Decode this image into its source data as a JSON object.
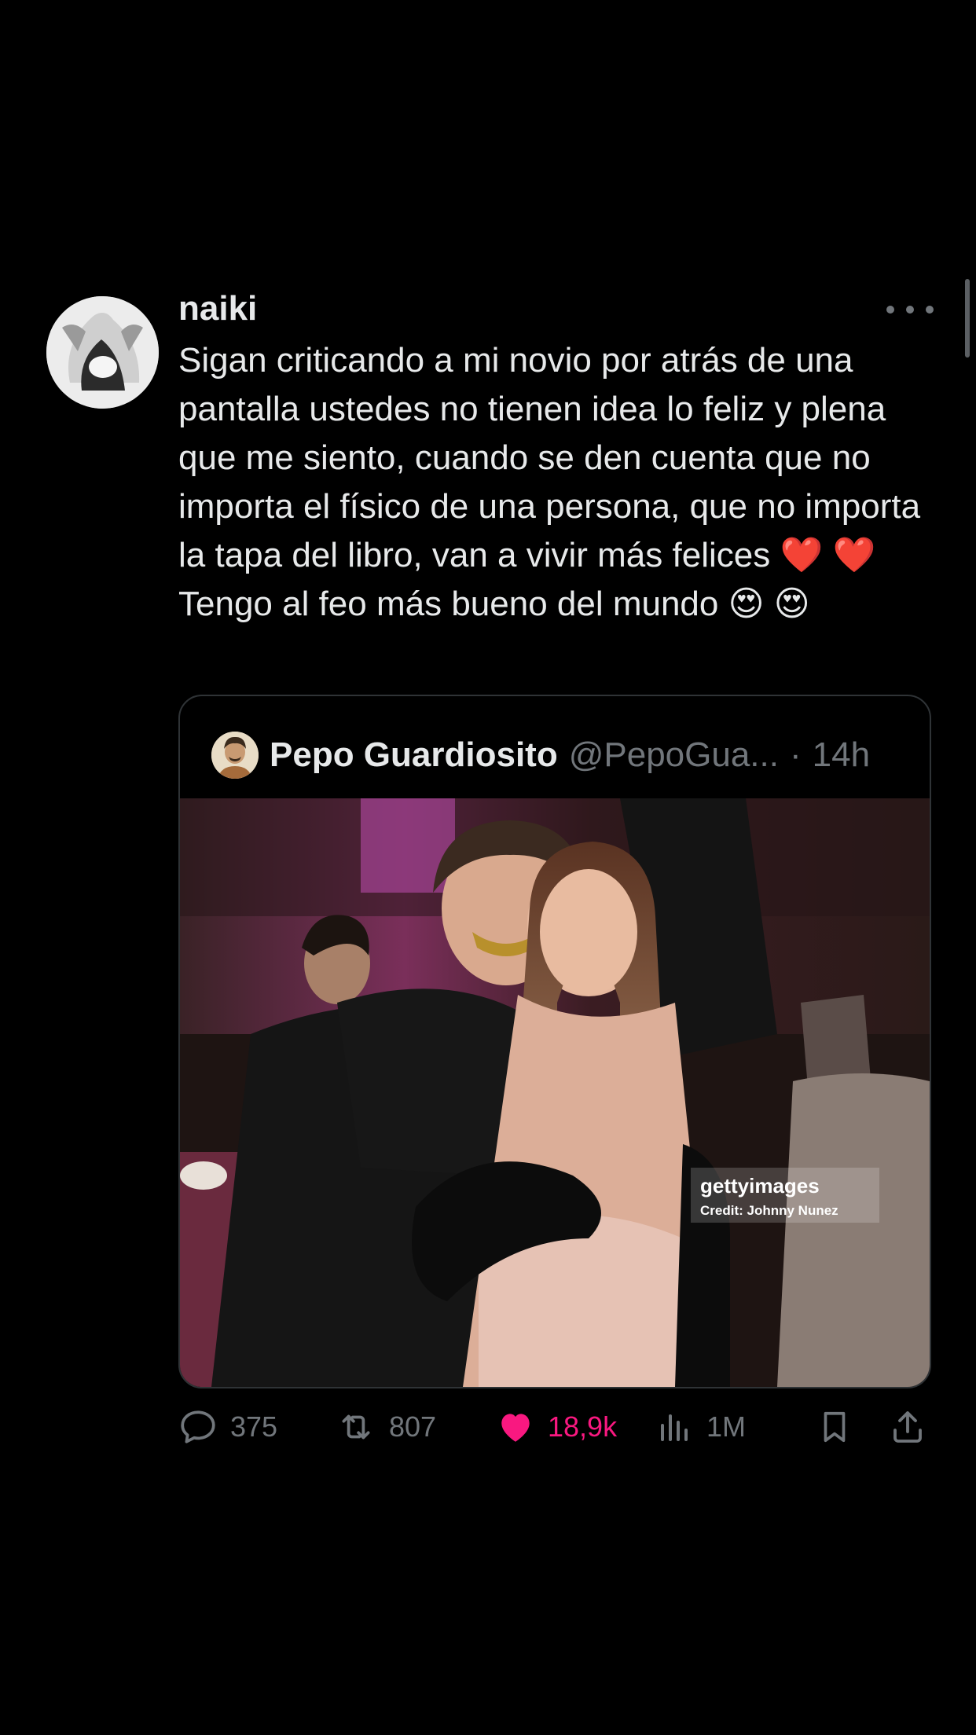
{
  "tweet": {
    "author": "naiki",
    "text": "Sigan criticando a mi novio por atrás de una pantalla ustedes no tienen idea lo feliz y plena que me siento, cuando se den cuenta que no importa el físico de una persona, que no importa la tapa del libro, van a vivir más felices ❤️ ❤️ Tengo al feo más bueno del mundo 😍 😍"
  },
  "quoted": {
    "name": "Pepo Guardiosito",
    "handle": "@PepoGua...",
    "separator": "·",
    "time": "14h",
    "watermark": {
      "brand": "gettyimages",
      "credit": "Credit: Johnny Nunez"
    }
  },
  "actions": {
    "replies": "375",
    "reposts": "807",
    "likes": "18,9k",
    "views": "1M"
  },
  "colors": {
    "background": "#000000",
    "text": "#e7e9ea",
    "muted": "#71767b",
    "like": "#f91880",
    "border": "#2f3336"
  }
}
